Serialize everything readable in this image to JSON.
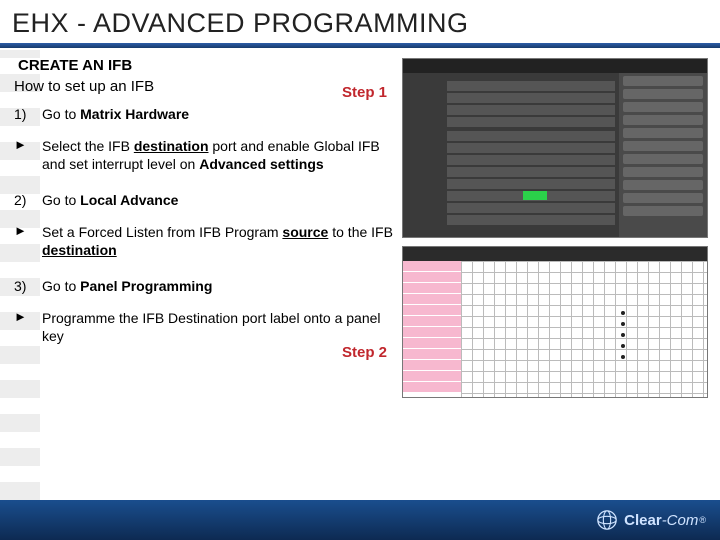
{
  "title": "EHX - ADVANCED PROGRAMMING",
  "section": {
    "heading": "CREATE AN IFB",
    "subheading": "How to set up an IFB"
  },
  "step_callouts": {
    "one": "Step 1",
    "two": "Step 2"
  },
  "items": {
    "n1": "1)",
    "t1a": "Go to ",
    "t1b": "Matrix Hardware",
    "t1d_a": "Select the IFB ",
    "t1d_b": "destination",
    "t1d_c": " port and enable Global IFB and set interrupt level on ",
    "t1d_d": "Advanced settings",
    "n2": "2)",
    "t2a": "Go to ",
    "t2b": "Local Advance",
    "t2d_a": "Set a Forced Listen from IFB Program ",
    "t2d_b": "source",
    "t2d_c": " to the IFB ",
    "t2d_d": "destination",
    "n3": "3)",
    "t3a": "Go to ",
    "t3b": "Panel Programming",
    "t3d": "Programme the IFB Destination port label onto a panel key"
  },
  "arrow": "►",
  "footer": {
    "brand_a": "Clear",
    "brand_b": "-Com",
    "reg": "®"
  },
  "colors": {
    "title_rule": "#1f4e8a",
    "step": "#c1272d",
    "footer_top": "#1a4e8e",
    "footer_bottom": "#0d2a52"
  }
}
